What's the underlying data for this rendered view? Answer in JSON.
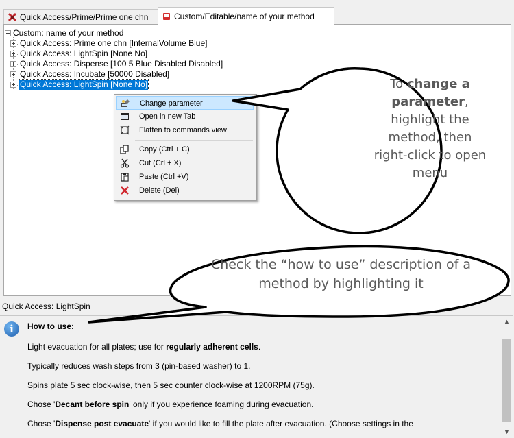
{
  "tabs": [
    {
      "label": "Quick Access/Prime/Prime one chn",
      "icon": "red-x-icon"
    },
    {
      "label": "Custom/Editable/name of your method",
      "icon": "red-book-icon"
    }
  ],
  "tree": {
    "root_label": "Custom: name of your method",
    "children": [
      "Quick Access: Prime one chn [InternalVolume Blue]",
      "Quick Access: LightSpin [None No]",
      "Quick Access: Dispense [100 5 Blue Disabled Disabled]",
      "Quick Access: Incubate [50000 Disabled]",
      "Quick Access: LightSpin [None No]"
    ]
  },
  "context_menu": {
    "items": [
      {
        "label": "Change parameter",
        "icon": "change-parameter-icon"
      },
      {
        "label": "Open in new Tab",
        "icon": "new-tab-icon"
      },
      {
        "label": "Flatten to commands view",
        "icon": "flatten-icon"
      },
      {
        "label": "Copy (Ctrl + C)",
        "icon": "copy-icon"
      },
      {
        "label": "Cut (Crl + X)",
        "icon": "scissors-icon"
      },
      {
        "label": "Paste (Ctrl +V)",
        "icon": "paste-icon"
      },
      {
        "label": "Delete (Del)",
        "icon": "delete-x-icon"
      }
    ]
  },
  "status_label": "Quick Access: LightSpin",
  "description": {
    "title": "How to use:",
    "line1_pre": "Light evacuation for all plates; use for ",
    "line1_bold": "regularly adherent cells",
    "line1_post": ".",
    "line2": "Typically reduces wash steps from 3 (pin-based washer) to 1.",
    "line3": "Spins plate 5 sec clock-wise, then 5 sec counter clock-wise at 1200RPM (75g).",
    "line4_pre": "Chose '",
    "line4_bold": "Decant before spin",
    "line4_post": "' only if you experience foaming during evacuation.",
    "line5_pre": "Chose '",
    "line5_bold": "Dispense post evacuate",
    "line5_post": "' if you would like to fill the plate after evacuation. (Choose settings in the"
  },
  "callout_right": {
    "pre": "To ",
    "bold": "change a parameter",
    "post": ", highlight the method, then right-click to open menu"
  },
  "callout_bottom": {
    "text": "Check the “how to use” description of a method by highlighting it"
  },
  "colors": {
    "selection": "#0078d7",
    "menu_highlight": "#cce8ff",
    "callout_stroke": "#000000",
    "callout_text": "#595959"
  }
}
